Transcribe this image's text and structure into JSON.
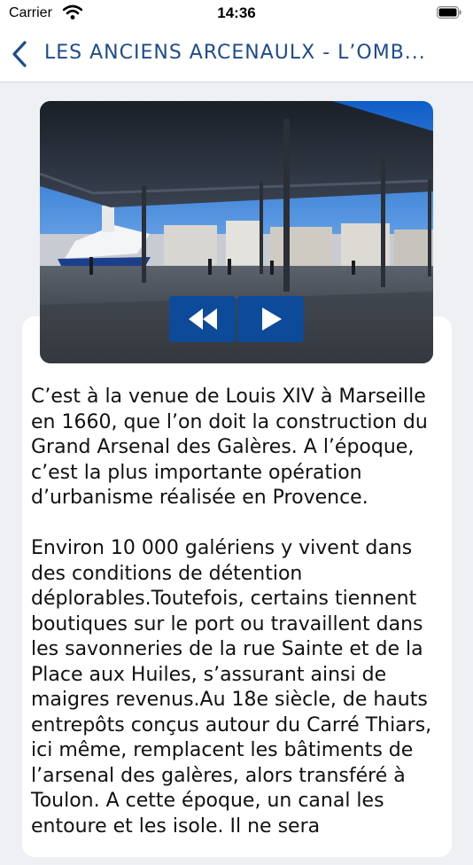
{
  "status_bar": {
    "carrier": "Carrier",
    "time": "14:36"
  },
  "nav": {
    "title": "LES ANCIENS ARCENAULX - L’OMB..."
  },
  "media": {
    "rewind_icon": "rewind-icon",
    "play_icon": "play-icon"
  },
  "article": {
    "paragraph_1": "C’est à la venue de Louis XIV à Marseille en 1660, que l’on doit la construction du Grand Arsenal des Galères. A l’époque, c’est la plus importante opération d’urbanisme réalisée en Provence.",
    "paragraph_2": "Environ 10 000 galériens y vivent dans des conditions de détention déplorables.Toutefois, certains tiennent boutiques sur le port ou travaillent dans les savonneries de la rue Sainte et de la Place aux Huiles, s’assurant ainsi de maigres revenus.Au 18e siècle, de hauts entrepôts conçus autour du Carré Thiars, ici même, remplacent les bâtiments de l’arsenal des galères, alors transféré à Toulon. A cette époque, un canal les entoure et les isole. Il ne sera"
  },
  "colors": {
    "accent": "#1e4b8e",
    "button": "#0d4a9a"
  }
}
